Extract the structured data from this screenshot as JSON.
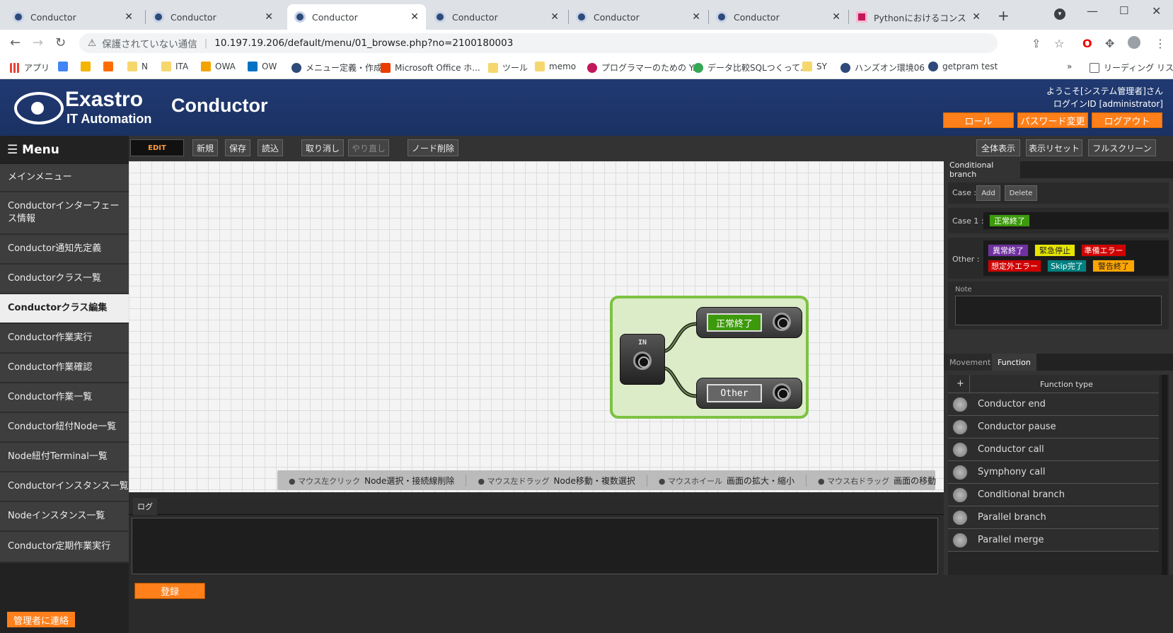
{
  "browser": {
    "tabs": [
      {
        "title": "Conductor",
        "active": false
      },
      {
        "title": "Conductor",
        "active": false
      },
      {
        "title": "Conductor",
        "active": true
      },
      {
        "title": "Conductor",
        "active": false
      },
      {
        "title": "Conductor",
        "active": false
      },
      {
        "title": "Conductor",
        "active": false
      },
      {
        "title": "Pythonにおけるコンストラク",
        "active": false
      }
    ],
    "security_label": "保護されていない通信",
    "url": "10.197.19.206/default/menu/01_browse.php?no=2100180003",
    "bookmarks": [
      "アプリ",
      "",
      "",
      "",
      "N",
      "ITA",
      "OWA",
      "OW",
      "メニュー定義・作成",
      "Microsoft Office ホ...",
      "ツール",
      "memo",
      "プログラマーのための Y...",
      "データ比較SQLつくって...",
      "SY",
      "ハンズオン環境06",
      "getpram test"
    ],
    "reading_list": "リーディング リスト"
  },
  "header": {
    "logo_main": "Exastro",
    "logo_sub": "IT Automation",
    "title": "Conductor",
    "welcome": "ようこそ[システム管理者]さん",
    "login_id": "ログインID [administrator]",
    "buttons": {
      "role": "ロール",
      "password": "パスワード変更",
      "logout": "ログアウト"
    }
  },
  "menu": {
    "title": "Menu",
    "items": [
      {
        "label": "メインメニュー",
        "active": false
      },
      {
        "label": "Conductorインターフェース情報",
        "active": false
      },
      {
        "label": "Conductor通知先定義",
        "active": false
      },
      {
        "label": "Conductorクラス一覧",
        "active": false
      },
      {
        "label": "Conductorクラス編集",
        "active": true
      },
      {
        "label": "Conductor作業実行",
        "active": false
      },
      {
        "label": "Conductor作業確認",
        "active": false
      },
      {
        "label": "Conductor作業一覧",
        "active": false
      },
      {
        "label": "Conductor紐付Node一覧",
        "active": false
      },
      {
        "label": "Node紐付Terminal一覧",
        "active": false
      },
      {
        "label": "Conductorインスタンス一覧",
        "active": false
      },
      {
        "label": "Nodeインスタンス一覧",
        "active": false
      },
      {
        "label": "Conductor定期作業実行",
        "active": false
      }
    ],
    "contact": "管理者に連絡"
  },
  "toolbar": {
    "mode": "EDIT",
    "new": "新規",
    "save": "保存",
    "load": "読込",
    "undo": "取り消し",
    "redo": "やり直し",
    "delete_node": "ノード削除",
    "show_all": "全体表示",
    "reset_view": "表示リセット",
    "fullscreen": "フルスクリーン"
  },
  "canvas": {
    "in_label": "IN",
    "terminals": [
      "正常終了",
      "Other"
    ],
    "hints": [
      {
        "mouse": "マウス左クリック",
        "action": "Node選択・接続線削除"
      },
      {
        "mouse": "マウス左ドラッグ",
        "action": "Node移動・複数選択"
      },
      {
        "mouse": "マウスホイール",
        "action": "画面の拡大・縮小"
      },
      {
        "mouse": "マウス右ドラッグ",
        "action": "画面の移動"
      }
    ]
  },
  "log": {
    "tab": "ログ",
    "register": "登録"
  },
  "panel": {
    "title": "Conditional branch",
    "case_label": "Case :",
    "add": "Add",
    "delete": "Delete",
    "case1_label": "Case 1 :",
    "case1_value": "正常終了",
    "other_label": "Other :",
    "other_values": [
      {
        "text": "異常終了",
        "color": "#7030a0"
      },
      {
        "text": "緊急停止",
        "color": "#e6e600"
      },
      {
        "text": "準備エラー",
        "color": "#d00000"
      },
      {
        "text": "想定外エラー",
        "color": "#d00000"
      },
      {
        "text": "Skip完了",
        "color": "#008080"
      },
      {
        "text": "警告終了",
        "color": "#ffa500"
      }
    ],
    "note_label": "Note",
    "tabs": {
      "movement": "Movement",
      "function": "Function"
    },
    "function_header": "Function type",
    "add_symbol": "+",
    "functions": [
      "Conductor end",
      "Conductor pause",
      "Conductor call",
      "Symphony call",
      "Conditional branch",
      "Parallel branch",
      "Parallel merge"
    ]
  }
}
